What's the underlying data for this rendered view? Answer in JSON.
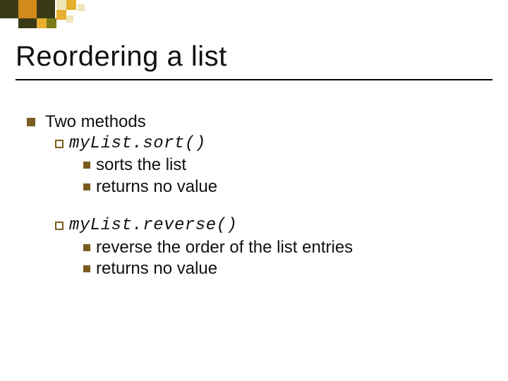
{
  "title": "Reordering a list",
  "l1": "Two methods",
  "m1": {
    "code_obj": "myList",
    "code_rest": ".sort()",
    "pt1": "sorts the list",
    "pt2": "returns no value"
  },
  "m2": {
    "code_obj": "myList",
    "code_rest": ".reverse()",
    "pt1": "reverse the order of  the list entries",
    "pt2": "returns no value"
  },
  "colors": {
    "dark": "#3a3a17",
    "olive": "#7b7b18",
    "orange": "#d28a1a",
    "gold": "#e6af2f",
    "pale": "#efe6b8"
  }
}
